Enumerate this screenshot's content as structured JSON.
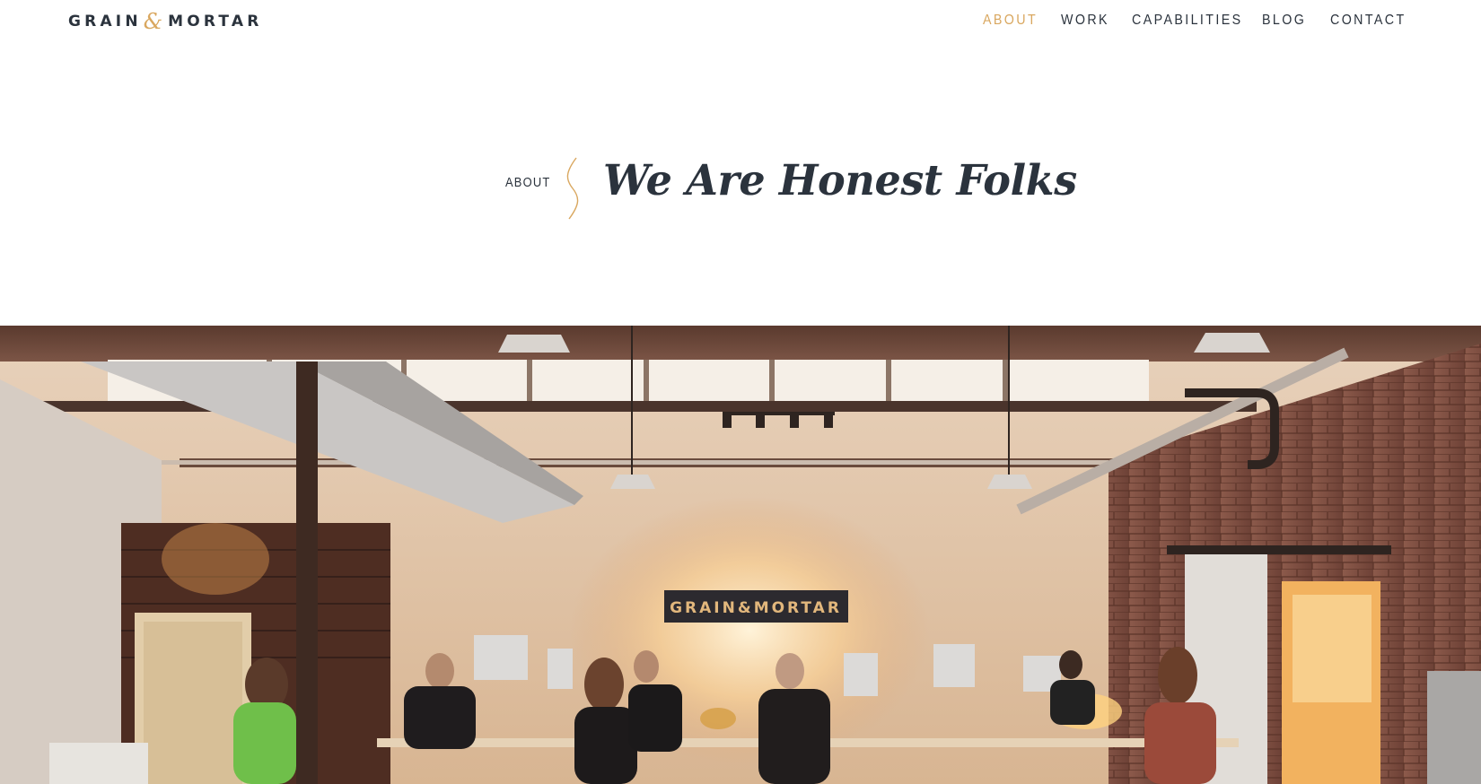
{
  "brand": {
    "logo_left": "GRAIN",
    "logo_amp": "&",
    "logo_right": "MORTAR"
  },
  "nav": {
    "items": [
      {
        "label": "ABOUT",
        "active": true
      },
      {
        "label": "WORK",
        "active": false
      },
      {
        "label": "CAPABILITIES",
        "active": false
      },
      {
        "label": "BLOG",
        "active": false
      },
      {
        "label": "CONTACT",
        "active": false
      }
    ]
  },
  "hero": {
    "kicker": "ABOUT",
    "headline": "We Are Honest Folks"
  },
  "photo": {
    "sign_left": "GRAIN",
    "sign_amp": "&",
    "sign_right": "MORTAR",
    "icon": "office-photo"
  },
  "colors": {
    "accent": "#d9a75f",
    "text": "#2b333d",
    "background": "#ffffff"
  }
}
